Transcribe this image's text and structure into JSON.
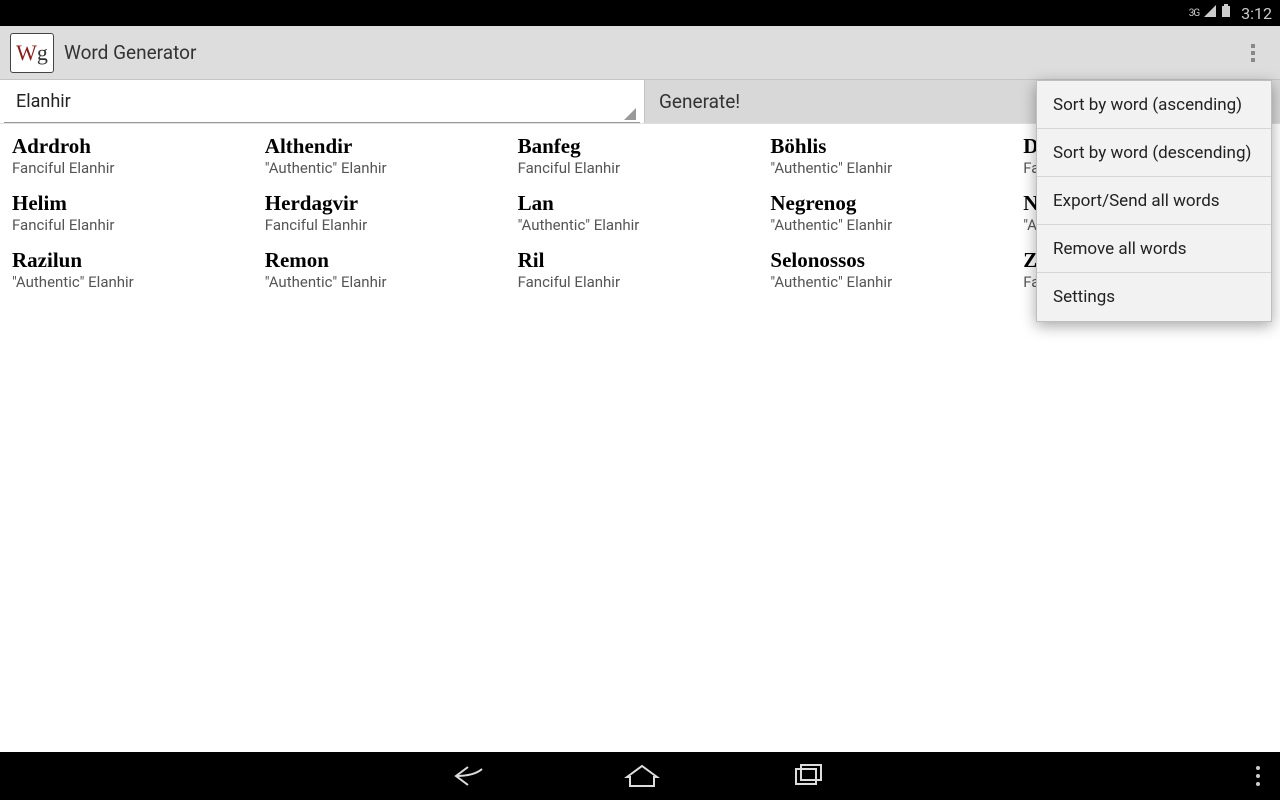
{
  "status": {
    "network": "3G",
    "clock": "3:12"
  },
  "app": {
    "icon_w": "W",
    "icon_g": "g",
    "title": "Word Generator"
  },
  "controls": {
    "spinner_value": "Elanhir",
    "generate_label": "Generate!"
  },
  "words": [
    {
      "word": "Adrdroh",
      "sub": "Fanciful Elanhir"
    },
    {
      "word": "Althendir",
      "sub": "\"Authentic\" Elanhir"
    },
    {
      "word": "Banfeg",
      "sub": "Fanciful Elanhir"
    },
    {
      "word": "Böhlis",
      "sub": "\"Authentic\" Elanhir"
    },
    {
      "word": "Dirdibdrur",
      "sub": "Fanciful Elanhir"
    },
    {
      "word": "Helim",
      "sub": "Fanciful Elanhir"
    },
    {
      "word": "Herdagvir",
      "sub": "Fanciful Elanhir"
    },
    {
      "word": "Lan",
      "sub": "\"Authentic\" Elanhir"
    },
    {
      "word": "Negrenog",
      "sub": "\"Authentic\" Elanhir"
    },
    {
      "word": "Nurak",
      "sub": "\"Authentic\" Elanhir"
    },
    {
      "word": "Razilun",
      "sub": "\"Authentic\" Elanhir"
    },
    {
      "word": "Remon",
      "sub": "\"Authentic\" Elanhir"
    },
    {
      "word": "Ril",
      "sub": "Fanciful Elanhir"
    },
    {
      "word": "Selonossos",
      "sub": "\"Authentic\" Elanhir"
    },
    {
      "word": "Zirnna",
      "sub": "Fanciful Elanhir"
    }
  ],
  "menu": {
    "items": [
      "Sort by word (ascending)",
      "Sort by word (descending)",
      "Export/Send all words",
      "Remove all words",
      "Settings"
    ]
  }
}
